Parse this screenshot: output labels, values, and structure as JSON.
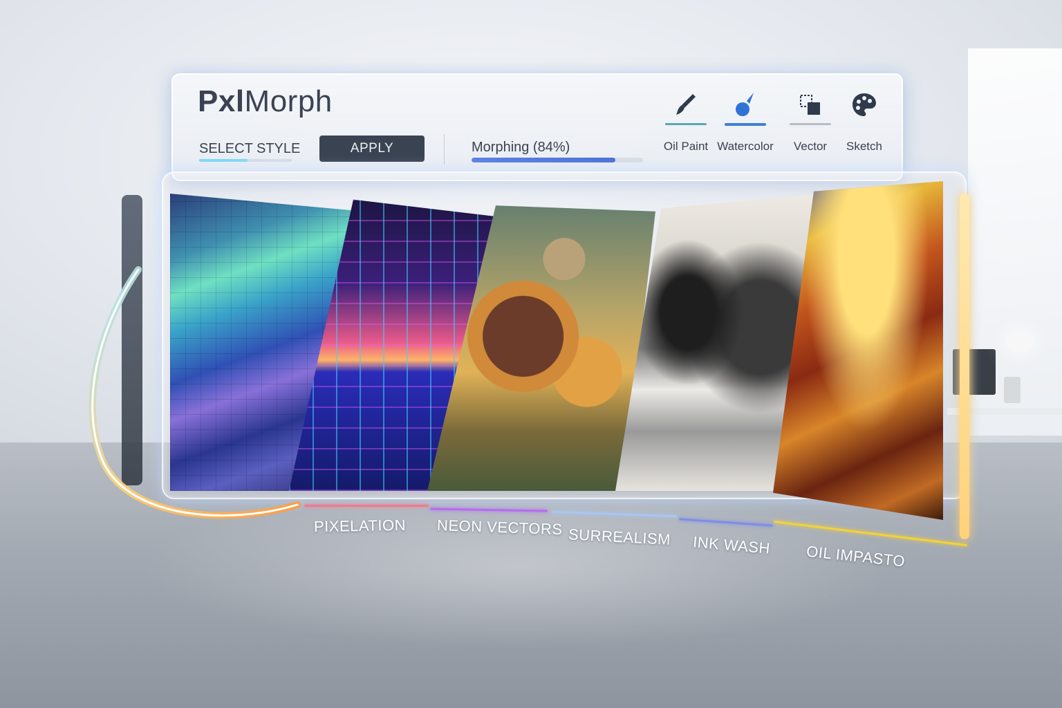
{
  "app": {
    "title_bold": "Pxl",
    "title_rest": "Morph"
  },
  "toolbar": {
    "select_style_label": "SELECT STYLE",
    "apply_label": "APPLY",
    "progress_label": "Morphing (84%)",
    "progress_value": 0.84,
    "tools": [
      {
        "label": "Oil Paint",
        "icon": "brush-icon",
        "bar_color": "#5aa7b3",
        "active": false
      },
      {
        "label": "Watercolor",
        "icon": "water-drop-icon",
        "bar_color": "#3f7fd6",
        "active": true
      },
      {
        "label": "Vector",
        "icon": "vector-icon",
        "bar_color": "#b8bcc3",
        "active": false
      },
      {
        "label": "Sketch",
        "icon": "palette-icon",
        "bar_color": "",
        "active": false
      }
    ]
  },
  "gallery": {
    "styles": [
      {
        "label": "PIXELATION",
        "color": "#f07a8a"
      },
      {
        "label": "NEON VECTORS",
        "color": "#b56cf0"
      },
      {
        "label": "SURREALISM",
        "color": "#a9c6f2"
      },
      {
        "label": "INK WASH",
        "color": "#7f8de6"
      },
      {
        "label": "OIL IMPASTO",
        "color": "#f2d23a"
      }
    ]
  },
  "colors": {
    "accent": "#3f7fd6",
    "button_dark": "#3a4352",
    "text": "#3a4150"
  }
}
